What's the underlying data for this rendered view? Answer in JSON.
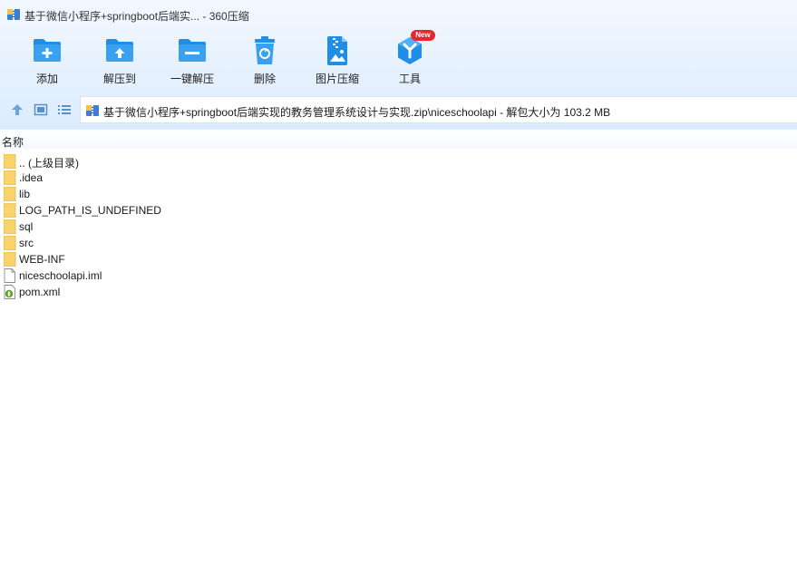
{
  "titlebar": {
    "title": "基于微信小程序+springboot后端实... - 360压缩"
  },
  "toolbar": {
    "items": [
      {
        "label": "添加",
        "icon": "add-folder-icon"
      },
      {
        "label": "解压到",
        "icon": "extract-to-icon"
      },
      {
        "label": "一键解压",
        "icon": "one-click-extract-icon"
      },
      {
        "label": "删除",
        "icon": "recycle-bin-icon"
      },
      {
        "label": "图片压缩",
        "icon": "image-compress-icon"
      },
      {
        "label": "工具",
        "icon": "tools-icon"
      }
    ],
    "new_badge": "New"
  },
  "navbar": {
    "path": "基于微信小程序+springboot后端实现的教务管理系统设计与实现.zip\\niceschoolapi - 解包大小为 103.2 MB"
  },
  "columns": {
    "name": "名称"
  },
  "files": [
    {
      "name": ".. (上级目录)",
      "type": "folder"
    },
    {
      "name": ".idea",
      "type": "folder"
    },
    {
      "name": "lib",
      "type": "folder"
    },
    {
      "name": "LOG_PATH_IS_UNDEFINED",
      "type": "folder"
    },
    {
      "name": "sql",
      "type": "folder"
    },
    {
      "name": "src",
      "type": "folder"
    },
    {
      "name": "WEB-INF",
      "type": "folder"
    },
    {
      "name": "niceschoolapi.iml",
      "type": "file"
    },
    {
      "name": "pom.xml",
      "type": "xml"
    }
  ],
  "colors": {
    "accent": "#1e8ee8",
    "folder": "#f9d36b",
    "badge": "#e8262c"
  }
}
